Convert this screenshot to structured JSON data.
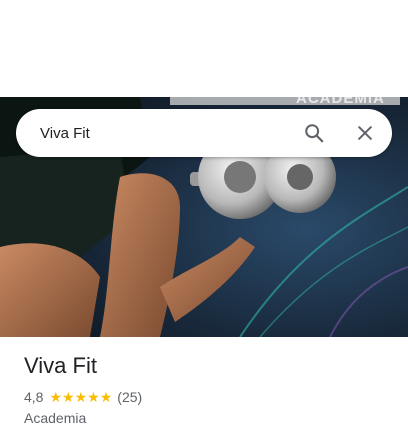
{
  "search": {
    "value": "Viva Fit"
  },
  "hero": {
    "brand_text": "ACADEMIA"
  },
  "place": {
    "name": "Viva Fit",
    "rating": "4,8",
    "stars": 5,
    "review_count": "(25)",
    "category": "Academia"
  },
  "colors": {
    "star": "#fbbc04",
    "text_primary": "#202124",
    "text_secondary": "#5f6368"
  },
  "icons": {
    "search": "search-icon",
    "close": "close-icon",
    "star": "star-icon"
  }
}
